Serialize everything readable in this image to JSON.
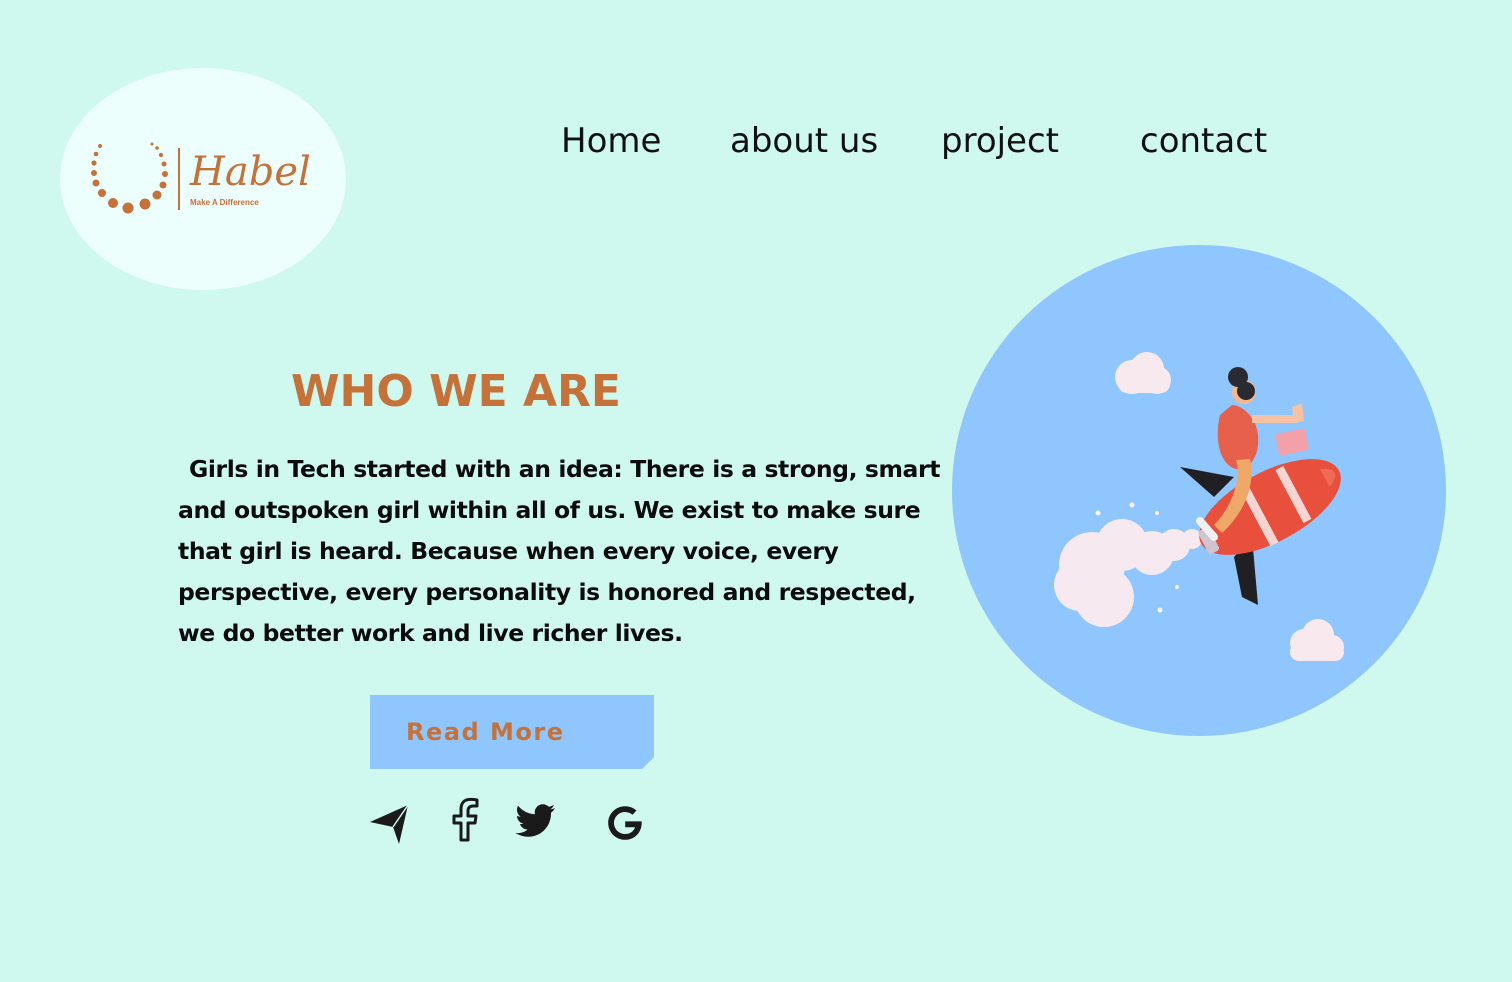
{
  "brand": {
    "name": "Habel",
    "tagline": "Make A Difference",
    "color": "#c5713a"
  },
  "nav": {
    "items": [
      {
        "label": "Home"
      },
      {
        "label": "about us"
      },
      {
        "label": "project"
      },
      {
        "label": "contact"
      }
    ]
  },
  "hero": {
    "title": "WHO WE ARE",
    "body": "Girls in Tech started with an idea: There is a strong, smart and outspoken girl within all of us. We exist to make sure that girl is heard. Because when every voice, every perspective, every personality is honored and respected, we do better work and live richer lives.",
    "button_label": "Read More"
  },
  "social": {
    "icons": [
      "send-icon",
      "facebook-icon",
      "twitter-icon",
      "google-icon"
    ]
  },
  "colors": {
    "background": "#cff8ef",
    "accent": "#c5713a",
    "button": "#8fc6fd",
    "circle": "#8fc6fd",
    "logo_bg": "#ecfffd"
  }
}
